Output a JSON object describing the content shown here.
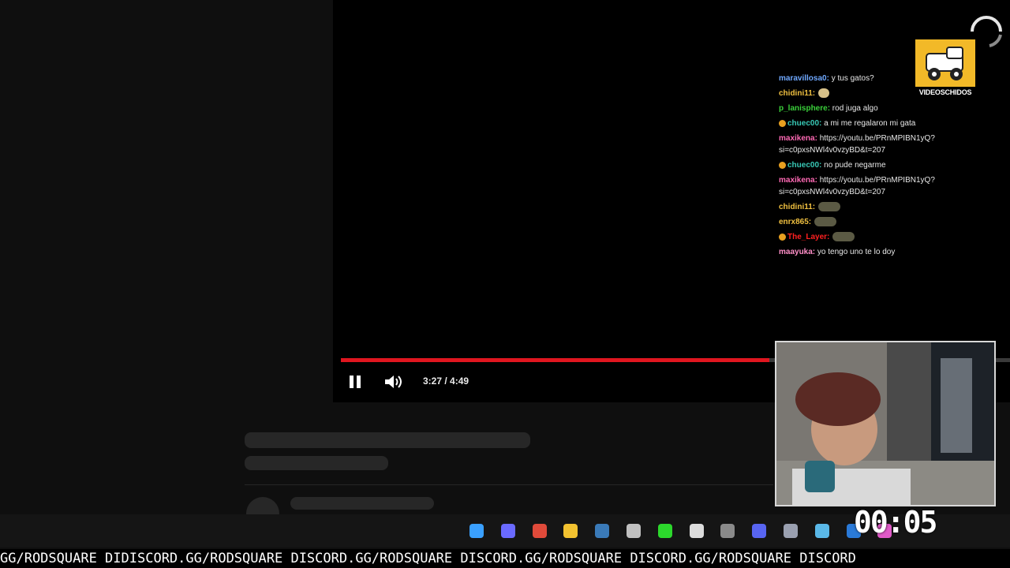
{
  "player": {
    "progress_fraction": 0.64,
    "time_display": "3:27 / 4:49",
    "progress_color": "#e0161f"
  },
  "chat": [
    {
      "user": "maravillosa0",
      "user_color": "#6fa8ff",
      "text": "y tus gatos?"
    },
    {
      "user": "chidini11",
      "user_color": "#f0c040",
      "text": "",
      "emote": "small"
    },
    {
      "user": "p_lanisphere",
      "user_color": "#3ad03a",
      "text": "rod juga algo"
    },
    {
      "user": "chuec00",
      "user_color": "#38c9b6",
      "text": "a mi me regalaron mi gata",
      "badge": true
    },
    {
      "user": "maxikena",
      "user_color": "#ff69b4",
      "text": "https://youtu.be/PRnMPIBN1yQ?si=c0pxsNWl4v0vzyBD&t=207"
    },
    {
      "user": "chuec00",
      "user_color": "#38c9b6",
      "text": "no pude negarme",
      "badge": true
    },
    {
      "user": "maxikena",
      "user_color": "#ff69b4",
      "text": "https://youtu.be/PRnMPIBN1yQ?si=c0pxsNWl4v0vzyBD&t=207"
    },
    {
      "user": "chidini11",
      "user_color": "#f0c040",
      "text": "",
      "emote": "big"
    },
    {
      "user": "enrx865",
      "user_color": "#f0c040",
      "text": "",
      "emote": "big"
    },
    {
      "user": "The_Layer",
      "user_color": "#ff2020",
      "text": "",
      "emote": "big",
      "badge": true
    },
    {
      "user": "maayuka",
      "user_color": "#ff8fc8",
      "text": "yo tengo uno te lo doy"
    }
  ],
  "logo": {
    "text": "VIDEOSCHIDOS"
  },
  "clock": "00:05",
  "ticker": "GG/RODSQUARE DIDISCORD.GG/RODSQUARE DISCORD.GG/RODSQUARE DISCORD.GG/RODSQUARE DISCORD.GG/RODSQUARE DISCORD",
  "taskbar": {
    "icons": [
      "windows-start-icon",
      "copilot-icon",
      "chrome-icon",
      "file-explorer-icon",
      "steam-icon",
      "obs-icon",
      "kick-icon",
      "app-icon",
      "keyboard-icon",
      "discord-icon",
      "folder-icon",
      "browser-icon",
      "vscode-icon",
      "color-app-icon"
    ]
  }
}
